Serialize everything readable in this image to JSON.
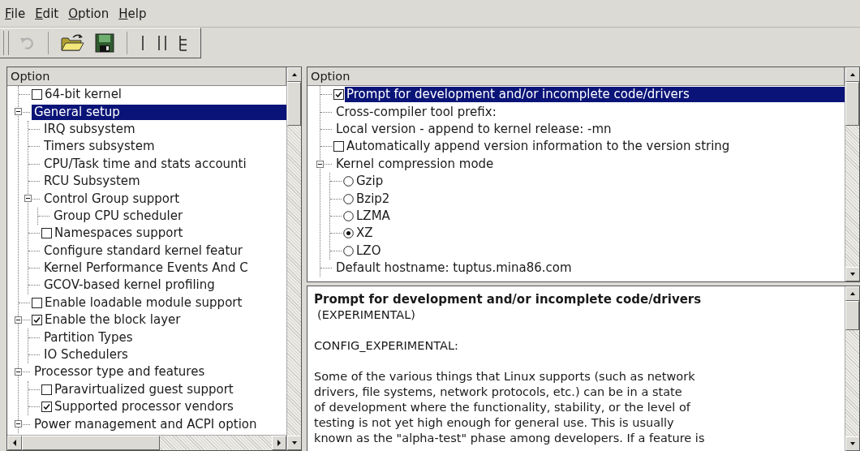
{
  "menu": [
    "File",
    "Edit",
    "Option",
    "Help"
  ],
  "toolbar": {
    "groups": [
      {
        "buttons": [
          {
            "kind": "undo",
            "disabled": true
          }
        ]
      },
      {
        "buttons": [
          {
            "kind": "open",
            "disabled": false
          },
          {
            "kind": "save",
            "disabled": false
          }
        ]
      },
      {
        "buttons": [
          {
            "kind": "single-view",
            "disabled": false
          },
          {
            "kind": "split-view",
            "disabled": false
          },
          {
            "kind": "full-view",
            "disabled": false
          }
        ]
      }
    ]
  },
  "left_tree": {
    "header": "Option",
    "items": [
      {
        "label": "64-bit kernel",
        "kind": "checkbox",
        "checked": false,
        "selected": false
      },
      {
        "label": "General setup",
        "kind": "plain",
        "selected": true,
        "expanded": true,
        "children": [
          {
            "label": "IRQ subsystem",
            "kind": "plain",
            "selected": false
          },
          {
            "label": "Timers subsystem",
            "kind": "plain",
            "selected": false
          },
          {
            "label": "CPU/Task time and stats accounti",
            "kind": "plain",
            "selected": false
          },
          {
            "label": "RCU Subsystem",
            "kind": "plain",
            "selected": false
          },
          {
            "label": "Control Group support",
            "kind": "plain",
            "selected": false,
            "expanded": true,
            "children": [
              {
                "label": "Group CPU scheduler",
                "kind": "plain",
                "selected": false
              }
            ]
          },
          {
            "label": "Namespaces support",
            "kind": "checkbox",
            "checked": false,
            "selected": false
          },
          {
            "label": "Configure standard kernel featur",
            "kind": "plain",
            "selected": false
          },
          {
            "label": "Kernel Performance Events And C",
            "kind": "plain",
            "selected": false
          },
          {
            "label": "GCOV-based kernel profiling",
            "kind": "plain",
            "selected": false
          }
        ]
      },
      {
        "label": "Enable loadable module support",
        "kind": "checkbox",
        "checked": false,
        "selected": false
      },
      {
        "label": "Enable the block layer",
        "kind": "checkbox",
        "checked": true,
        "selected": false,
        "expanded": true,
        "children": [
          {
            "label": "Partition Types",
            "kind": "plain",
            "selected": false
          },
          {
            "label": "IO Schedulers",
            "kind": "plain",
            "selected": false
          }
        ]
      },
      {
        "label": "Processor type and features",
        "kind": "plain",
        "selected": false,
        "expanded": true,
        "children": [
          {
            "label": "Paravirtualized guest support",
            "kind": "checkbox",
            "checked": false,
            "selected": false
          },
          {
            "label": "Supported processor vendors",
            "kind": "checkbox",
            "checked": true,
            "selected": false
          }
        ]
      },
      {
        "label": "Power management and ACPI option",
        "kind": "plain",
        "selected": false,
        "expanded": true
      }
    ]
  },
  "right_tree": {
    "header": "Option",
    "items": [
      {
        "label": "Prompt for development and/or incomplete code/drivers",
        "kind": "checkbox",
        "checked": true,
        "selected": true
      },
      {
        "label": "Cross-compiler tool prefix:",
        "kind": "plain",
        "selected": false
      },
      {
        "label": "Local version - append to kernel release: -mn",
        "kind": "plain",
        "selected": false
      },
      {
        "label": "Automatically append version information to the version string",
        "kind": "checkbox",
        "checked": false,
        "selected": false
      },
      {
        "label": "Kernel compression mode",
        "kind": "plain",
        "selected": false,
        "expanded": true,
        "children": [
          {
            "label": "Gzip",
            "kind": "radio",
            "checked": false,
            "selected": false
          },
          {
            "label": "Bzip2",
            "kind": "radio",
            "checked": false,
            "selected": false
          },
          {
            "label": "LZMA",
            "kind": "radio",
            "checked": false,
            "selected": false
          },
          {
            "label": "XZ",
            "kind": "radio",
            "checked": true,
            "selected": false
          },
          {
            "label": "LZO",
            "kind": "radio",
            "checked": false,
            "selected": false
          }
        ]
      },
      {
        "label": "Default hostname: tuptus.mina86.com",
        "kind": "plain",
        "selected": false
      }
    ]
  },
  "help": {
    "title": "Prompt for development and/or incomplete code/drivers",
    "subtitle": "(EXPERIMENTAL)",
    "symbol": "CONFIG_EXPERIMENTAL:",
    "text": "Some of the various things that Linux supports (such as network\ndrivers, file systems, network protocols, etc.) can be in a state\nof development where the functionality, stability, or the level of\ntesting is not yet high enough for general use. This is usually\nknown as the \"alpha-test\" phase among developers. If a feature is"
  }
}
